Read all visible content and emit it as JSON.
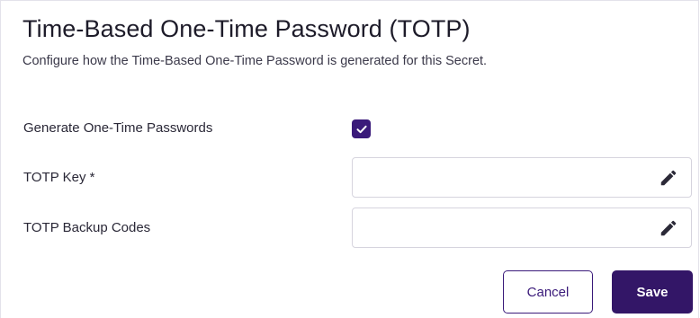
{
  "dialog": {
    "title": "Time-Based One-Time Password (TOTP)",
    "description": "Configure how the Time-Based One-Time Password is generated for this Secret."
  },
  "form": {
    "generate_otp": {
      "label": "Generate One-Time Passwords",
      "checked": true
    },
    "totp_key": {
      "label": "TOTP Key *",
      "value": "",
      "icon": "pencil-edit-icon"
    },
    "totp_backup_codes": {
      "label": "TOTP Backup Codes",
      "value": "",
      "icon": "pencil-edit-icon"
    }
  },
  "actions": {
    "cancel_label": "Cancel",
    "save_label": "Save"
  },
  "colors": {
    "accent": "#331667",
    "field_border": "#d6d4de",
    "text": "#1f1d2b"
  }
}
